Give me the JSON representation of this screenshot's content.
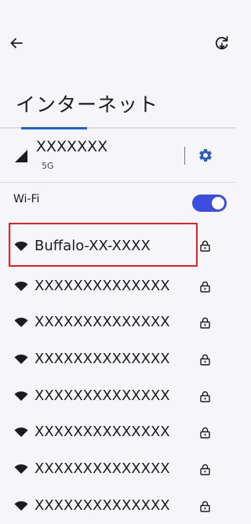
{
  "header": {
    "title": "インターネット",
    "back_icon": "arrow-back-icon",
    "reset_icon": "network-reset-icon"
  },
  "mobile": {
    "carrier": "XXXXXXX",
    "network_type": "5G",
    "signal_icon": "cellular-signal-icon",
    "settings_icon": "gear-icon"
  },
  "wifi": {
    "label": "Wi-Fi",
    "enabled": true,
    "networks": [
      {
        "ssid": "Buffalo-XX-XXXX",
        "locked": true,
        "highlighted": true
      },
      {
        "ssid": "XXXXXXXXXXXXXX",
        "locked": true
      },
      {
        "ssid": "XXXXXXXXXXXXXX",
        "locked": true
      },
      {
        "ssid": "XXXXXXXXXXXXXX",
        "locked": true
      },
      {
        "ssid": "XXXXXXXXXXXXXX",
        "locked": true
      },
      {
        "ssid": "XXXXXXXXXXXXXX",
        "locked": true
      },
      {
        "ssid": "XXXXXXXXXXXXXX",
        "locked": true
      },
      {
        "ssid": "XXXXXXXXXXXXXX",
        "locked": true
      }
    ]
  },
  "colors": {
    "accent": "#3d4de0",
    "tab_indicator": "#2b5fbf",
    "highlight": "#e52122",
    "background": "#f6f5f9"
  }
}
